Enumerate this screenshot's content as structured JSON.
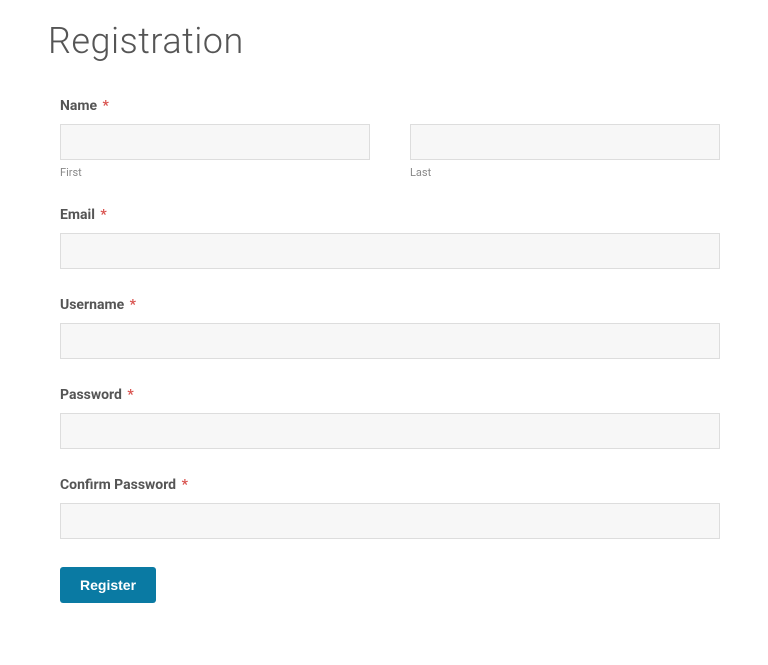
{
  "page": {
    "title": "Registration"
  },
  "form": {
    "name": {
      "label": "Name",
      "required_marker": "*",
      "first_sublabel": "First",
      "last_sublabel": "Last",
      "first_value": "",
      "last_value": ""
    },
    "email": {
      "label": "Email",
      "required_marker": "*",
      "value": ""
    },
    "username": {
      "label": "Username",
      "required_marker": "*",
      "value": ""
    },
    "password": {
      "label": "Password",
      "required_marker": "*",
      "value": ""
    },
    "confirm_password": {
      "label": "Confirm Password",
      "required_marker": "*",
      "value": ""
    },
    "submit": {
      "label": "Register"
    }
  }
}
